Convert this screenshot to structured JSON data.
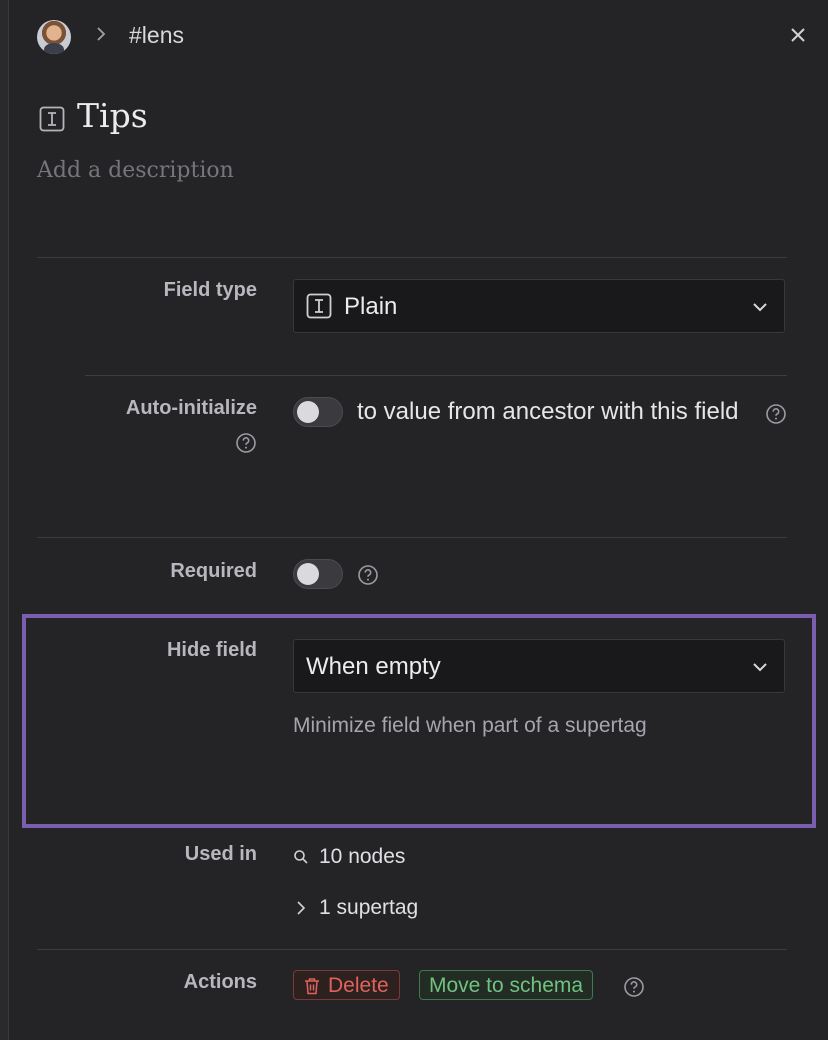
{
  "breadcrumb": {
    "tag": "#lens"
  },
  "header": {
    "title": "Tips",
    "description_placeholder": "Add a description"
  },
  "fields": {
    "field_type": {
      "label": "Field type",
      "value": "Plain"
    },
    "auto_initialize": {
      "label": "Auto-initialize",
      "text": "to value from ancestor with this field",
      "enabled": false
    },
    "required": {
      "label": "Required",
      "enabled": false
    },
    "hide_field": {
      "label": "Hide field",
      "value": "When empty",
      "hint": "Minimize field when part of a supertag"
    },
    "used_in": {
      "label": "Used in",
      "nodes": "10 nodes",
      "supertag": "1 supertag"
    },
    "actions": {
      "label": "Actions",
      "delete": "Delete",
      "move": "Move to schema"
    }
  },
  "colors": {
    "highlight": "#7a5fb0",
    "delete": "#e0625a",
    "move": "#6fc27f"
  }
}
